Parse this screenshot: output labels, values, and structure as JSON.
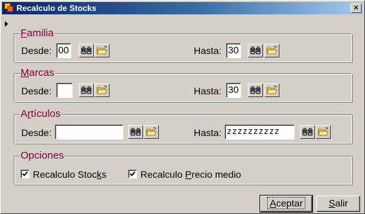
{
  "window": {
    "title": "Recalculo de Stocks",
    "close_glyph": "×"
  },
  "familia": {
    "legend": "Familia",
    "legend_first": "F",
    "legend_rest": "amilia",
    "desde_label": "Desde:",
    "desde_value": "00",
    "hasta_label": "Hasta:",
    "hasta_value": "30"
  },
  "marcas": {
    "legend": "Marcas",
    "legend_first": "M",
    "legend_rest": "arcas",
    "desde_label": "Desde:",
    "desde_value": "",
    "hasta_label": "Hasta:",
    "hasta_value": "30"
  },
  "articulos": {
    "legend": "Artículos",
    "legend_pre": "A",
    "legend_ul": "r",
    "legend_post": "tículos",
    "desde_label": "Desde:",
    "desde_value": "",
    "hasta_label": "Hasta:",
    "hasta_value": "zzzzzzzzzz"
  },
  "opciones": {
    "legend": "Opciones",
    "recalculo_stocks_label": "Recalculo Stocks",
    "recalculo_stocks_pre": "Recalculo Stoc",
    "recalculo_stocks_ul": "k",
    "recalculo_stocks_post": "s",
    "recalculo_stocks_checked": true,
    "precio_medio_label": "Recalculo Precio medio",
    "precio_medio_pre": "Recalculo ",
    "precio_medio_ul": "P",
    "precio_medio_post": "recio medio",
    "precio_medio_checked": true
  },
  "buttons": {
    "aceptar_label": "Aceptar",
    "aceptar_ul": "A",
    "aceptar_rest": "ceptar",
    "salir_label": "Salir",
    "salir_ul": "S",
    "salir_rest": "alir"
  },
  "icons": {
    "search": "binoculars-icon",
    "open": "open-folder-icon",
    "app": "app-icon",
    "close": "close-icon",
    "check": "checkmark-icon"
  },
  "colors": {
    "legend": "#800040",
    "title_gradient_start": "#0a246a",
    "title_gradient_end": "#a6caf0",
    "face": "#d4d0c8"
  }
}
